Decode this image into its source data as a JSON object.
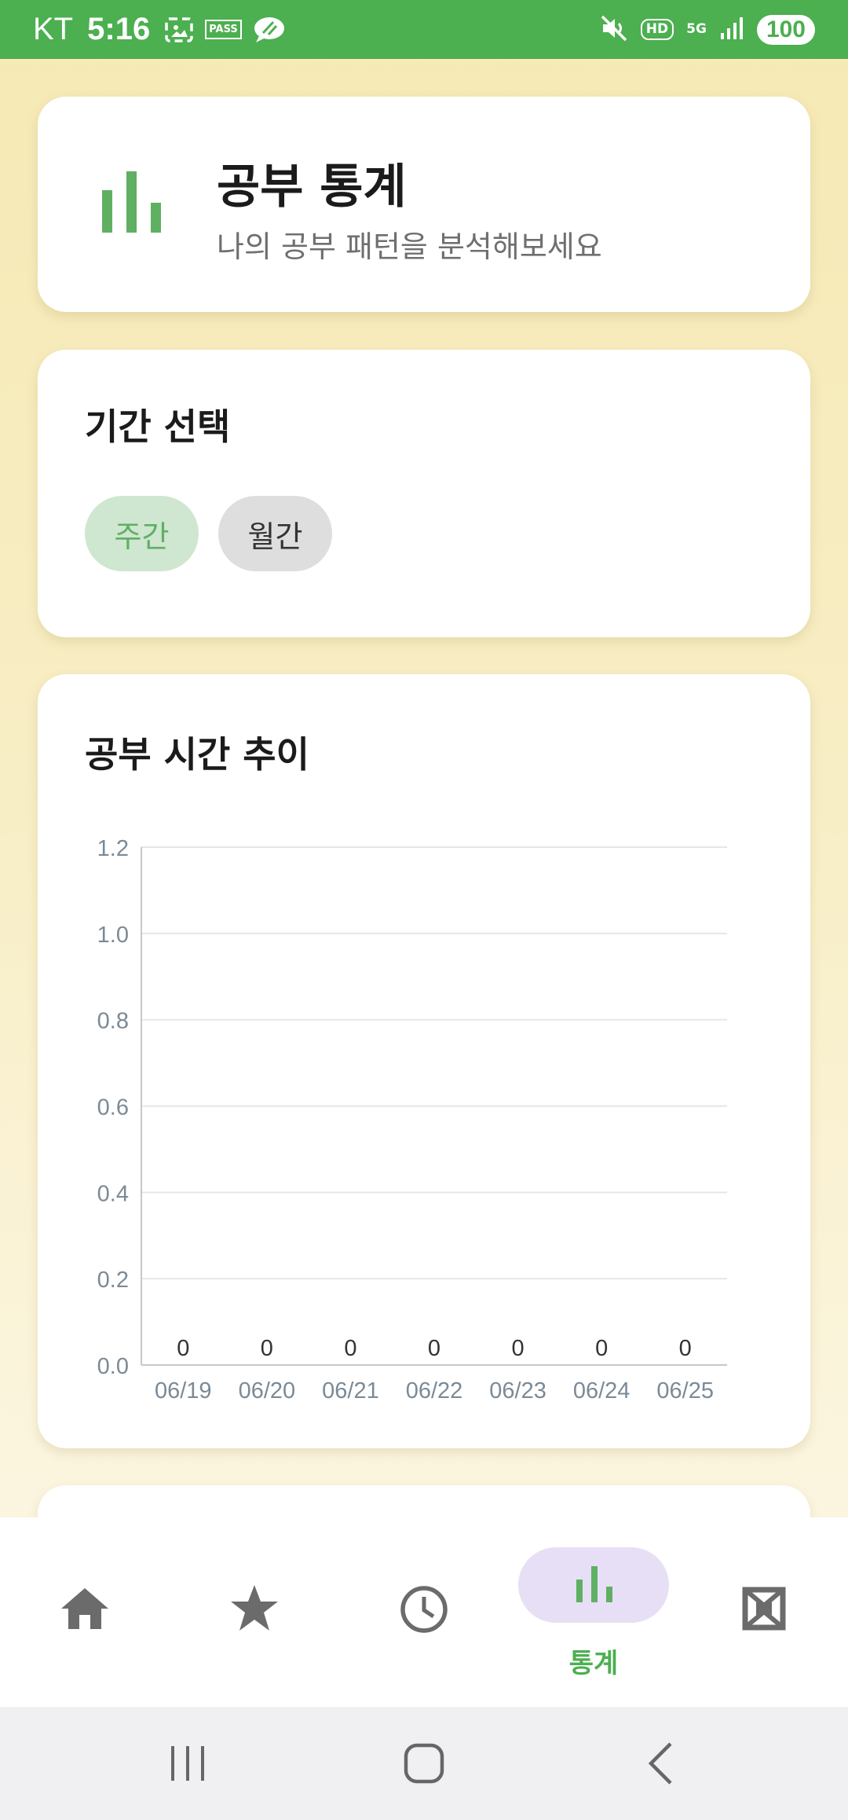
{
  "status_bar": {
    "carrier": "KT",
    "time": "5:16",
    "pass_label": "PASS",
    "hd_label": "HD",
    "network_label": "5G",
    "battery": "100"
  },
  "header": {
    "title": "공부 통계",
    "subtitle": "나의 공부 패턴을 분석해보세요",
    "icon": "bar-chart-icon"
  },
  "period": {
    "title": "기간 선택",
    "options": [
      "주간",
      "월간"
    ],
    "selected": "주간"
  },
  "chart_section": {
    "title": "공부 시간 추이"
  },
  "chart_data": {
    "type": "line",
    "categories": [
      "06/19",
      "06/20",
      "06/21",
      "06/22",
      "06/23",
      "06/24",
      "06/25"
    ],
    "values": [
      0,
      0,
      0,
      0,
      0,
      0,
      0
    ],
    "data_labels": [
      "0",
      "0",
      "0",
      "0",
      "0",
      "0",
      "0"
    ],
    "yticks": [
      "0.0",
      "0.2",
      "0.4",
      "0.6",
      "0.8",
      "1.0",
      "1.2"
    ],
    "ylim": [
      0,
      1.2
    ],
    "grid": true
  },
  "bottom_nav": {
    "items": [
      {
        "icon": "home-icon",
        "label": ""
      },
      {
        "icon": "star-icon",
        "label": ""
      },
      {
        "icon": "clock-icon",
        "label": ""
      },
      {
        "icon": "bar-chart-icon",
        "label": "통계",
        "active": true
      },
      {
        "icon": "gallery-icon",
        "label": ""
      }
    ]
  },
  "colors": {
    "accent": "#4caf50",
    "status_bar": "#4caf50",
    "active_chip_bg": "#cfe6d0",
    "active_nav_pill": "#e7dff5"
  }
}
